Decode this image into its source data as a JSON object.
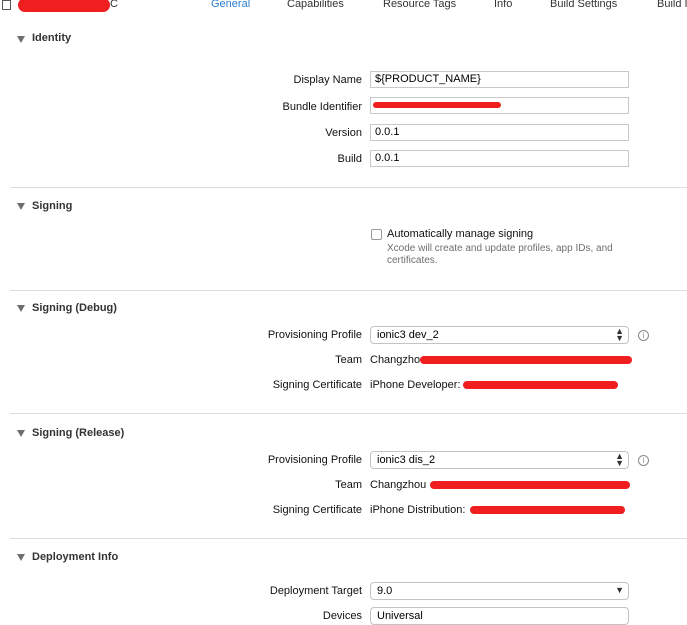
{
  "tabs": [
    {
      "label": "General",
      "active": true
    },
    {
      "label": "Capabilities"
    },
    {
      "label": "Resource Tags"
    },
    {
      "label": "Info"
    },
    {
      "label": "Build Settings"
    },
    {
      "label": "Build I"
    }
  ],
  "target_name_suffix": "C",
  "identity": {
    "title": "Identity",
    "display_name_label": "Display Name",
    "display_name_value": "${PRODUCT_NAME}",
    "bundle_id_label": "Bundle Identifier",
    "version_label": "Version",
    "version_value": "0.0.1",
    "build_label": "Build",
    "build_value": "0.0.1"
  },
  "signing": {
    "title": "Signing",
    "auto_label": "Automatically manage signing",
    "auto_checked": false,
    "auto_note": "Xcode will create and update profiles, app IDs, and certificates."
  },
  "signing_debug": {
    "title": "Signing (Debug)",
    "profile_label": "Provisioning Profile",
    "profile_value": "ionic3 dev_2",
    "team_label": "Team",
    "team_value": "Changzhou",
    "cert_label": "Signing Certificate",
    "cert_value": "iPhone Developer:"
  },
  "signing_release": {
    "title": "Signing (Release)",
    "profile_label": "Provisioning Profile",
    "profile_value": "ionic3 dis_2",
    "team_label": "Team",
    "team_value": "Changzhou",
    "cert_label": "Signing Certificate",
    "cert_value": "iPhone Distribution:"
  },
  "deployment": {
    "title": "Deployment Info",
    "target_label": "Deployment Target",
    "target_value": "9.0",
    "devices_label": "Devices",
    "devices_value": "Universal"
  },
  "colors": {
    "accent": "#2a7ecb",
    "redaction": "#f01e1e"
  },
  "icons": {
    "info": "info-circle-icon",
    "disclosure": "disclosure-triangle-icon",
    "popup": "up-down-chevron-icon"
  }
}
